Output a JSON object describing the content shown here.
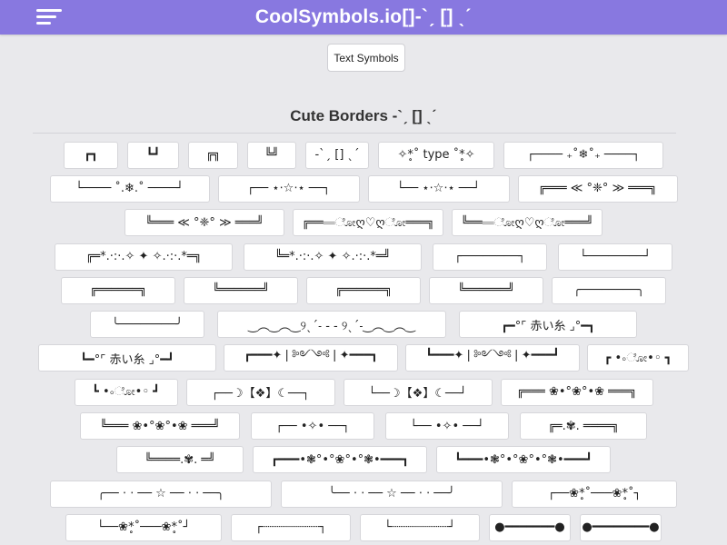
{
  "header": {
    "site_title": "CoolSymbols.io[]-`ˏ [] ˎˊ",
    "background_color": "#8878e0",
    "menu_icon": "hamburger-menu-icon"
  },
  "nav": {
    "text_symbols_label": "Text Symbols"
  },
  "section": {
    "title": "Cute Borders -`ˏ [] ˎˊ"
  },
  "borders": [
    [
      "┏┓",
      "┗┛",
      "╔╗",
      "╚╝",
      "-`ˏ [] ˎˊ",
      "✧*̥˚ type ˚*̥✧",
      "┌──── ₊˚❄˚₊ ────┐"
    ],
    [
      "└──── ˚.❄.˚ ────┘",
      "┌── ⋆⋅☆⋅⋆ ──┐",
      "└── ⋆⋅☆⋅⋆ ──┘",
      "╔═══ ≪ °❈° ≫ ═══╗"
    ],
    [
      "╚═══ ≪ °❈° ≫ ═══╝",
      "╔═══ೋღ♡ღೋ═══╗",
      "╚═══ೋღ♡ღೋ═══╝"
    ],
    [
      "╔═*.·:·.✧ ✦ ✧.·:·.*═╗",
      "╚═*.·:·.✧ ✦ ✧.·:·.*═╝",
      "┌────────┐",
      "└────────┘"
    ],
    [
      "╔══════╗",
      "╚══════╝",
      "╔══════╗",
      "╚══════╝",
      "╭────────╮"
    ],
    [
      "╰────────╯",
      "‿︵‿︵‿୨ˎˊ˗ - - ୨ˎˊ˗‿︵‿︵‿",
      "┏━°⌜ 赤い糸 ⌟°━┓"
    ],
    [
      "┗━°⌜ 赤い糸 ⌟°━┛",
      "┏━━━✦❘༻༺❘✦━━━┓",
      "┗━━━✦❘༻༺❘✦━━━┛",
      "┏ •◦ೋ•◦ ┓"
    ],
    [
      "┗ •◦ೋ•◦ ┛",
      "┌──☽【❖】☾──┐",
      "└──☽【❖】☾──┘",
      "╔═══ ❀•°❀°•❀ ═══╗"
    ],
    [
      "╚═══ ❀•°❀°•❀ ═══╝",
      "┌── •✧• ──┐",
      "└── •✧• ──┘",
      "╔═.✾. ════╗"
    ],
    [
      "╚════.✾. ═╝",
      "┏━━━•❃°•°❀°•°❃•━━━┓",
      "┗━━━•❃°•°❀°•°❃•━━━┛"
    ],
    [
      "╭── ⋅ ⋅ ── ☆ ── ⋅ ⋅ ──╮",
      "╰── ⋅ ⋅ ── ☆ ── ⋅ ⋅ ──╯",
      "┌──❀*̥˚───❀*̥˚┐"
    ],
    [
      "└──❀*̥˚───❀*̥˚┘",
      "┌┈┈┈┈┈┈┈┈┐",
      "└┈┈┈┈┈┈┈┈┘",
      "●━━━━━━━●",
      "●━━━━━━━━●"
    ]
  ]
}
